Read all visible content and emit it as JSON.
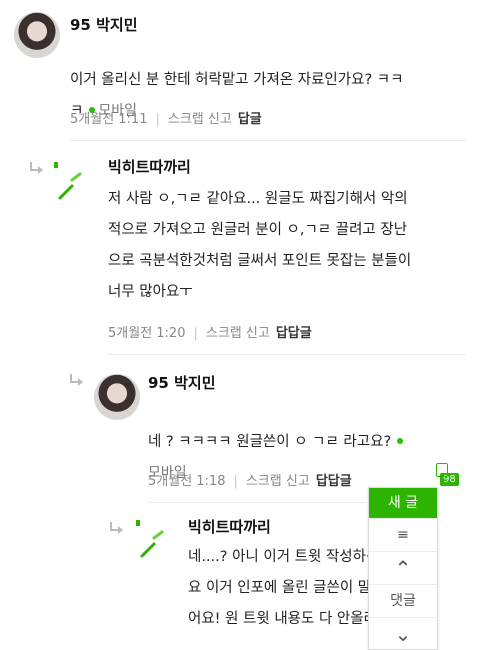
{
  "comments": [
    {
      "nickname": "95 박지민",
      "text": "이거 올리신 분 한테 허락맡고 가져온 자료인가요? ㅋㅋ\nㅋ",
      "device": "모바일",
      "time": "5개월전 1:11",
      "report": "스크랩 신고",
      "reply": "답글"
    },
    {
      "nickname": "빅히트따까리",
      "text": "저 사람 ㅇ,ㄱㄹ 같아요... 원글도 짜집기해서 악의\n적으로 가져오고 원글러 분이 ㅇ,ㄱㄹ 끌려고 장난\n으로 곡분석한것처럼 글써서 포인트 못잡는 분들이\n너무 많아요ㅜ",
      "time": "5개월전 1:20",
      "report": "스크랩 신고",
      "reply": "답답글"
    },
    {
      "nickname": "95 박지민",
      "text": "네 ? ㅋㅋㅋㅋ 원글쓴이 ㅇ ㄱㄹ 라고요?",
      "device": "모바일",
      "time": "5개월전 1:18",
      "report": "스크랩 신고",
      "reply": "답답글"
    },
    {
      "nickname": "빅히트따까리",
      "text": "네....? 아니 이거 트윗 작성하신 분 말구\n요 이거 인포에 올린 글쓴이 말하는거였\n어요! 원 트윗 내용도 다 안올라와있고"
    }
  ],
  "fab": {
    "write": "새 글",
    "badge": "98",
    "menu_icon": "≡",
    "up_icon": "⌃",
    "comment_label": "댓글",
    "down_icon": "⌄"
  },
  "colors": {
    "accent": "#2db400",
    "dot": "#1ec800"
  }
}
